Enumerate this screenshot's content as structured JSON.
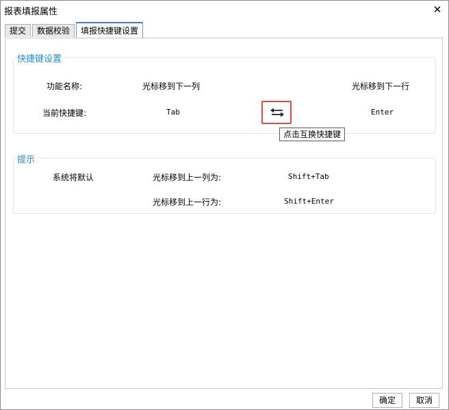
{
  "window": {
    "title": "报表填报属性"
  },
  "tabs": [
    {
      "label": "提交"
    },
    {
      "label": "数据校验"
    },
    {
      "label": "填报快捷键设置"
    }
  ],
  "shortcut_settings": {
    "group_title": "快捷键设置",
    "function_name_label": "功能名称:",
    "col_function": "光标移到下一列",
    "row_function": "光标移到下一行",
    "current_shortcut_label": "当前快捷键:",
    "col_shortcut": "Tab",
    "row_shortcut": "Enter",
    "swap_tooltip": "点击互换快捷键",
    "swap_icon": "swap-arrows-icon"
  },
  "tips": {
    "group_title": "提示",
    "default_label": "系统将默认",
    "prev_col_label": "光标移到上一列为:",
    "prev_col_value": "Shift+Tab",
    "prev_row_label": "光标移到上一行为:",
    "prev_row_value": "Shift+Enter"
  },
  "footer": {
    "ok_label": "确定",
    "cancel_label": "取消"
  },
  "colors": {
    "accent": "#1e8fd6",
    "highlight_border": "#e2463f",
    "active_tab_border": "#3c7fc8"
  }
}
